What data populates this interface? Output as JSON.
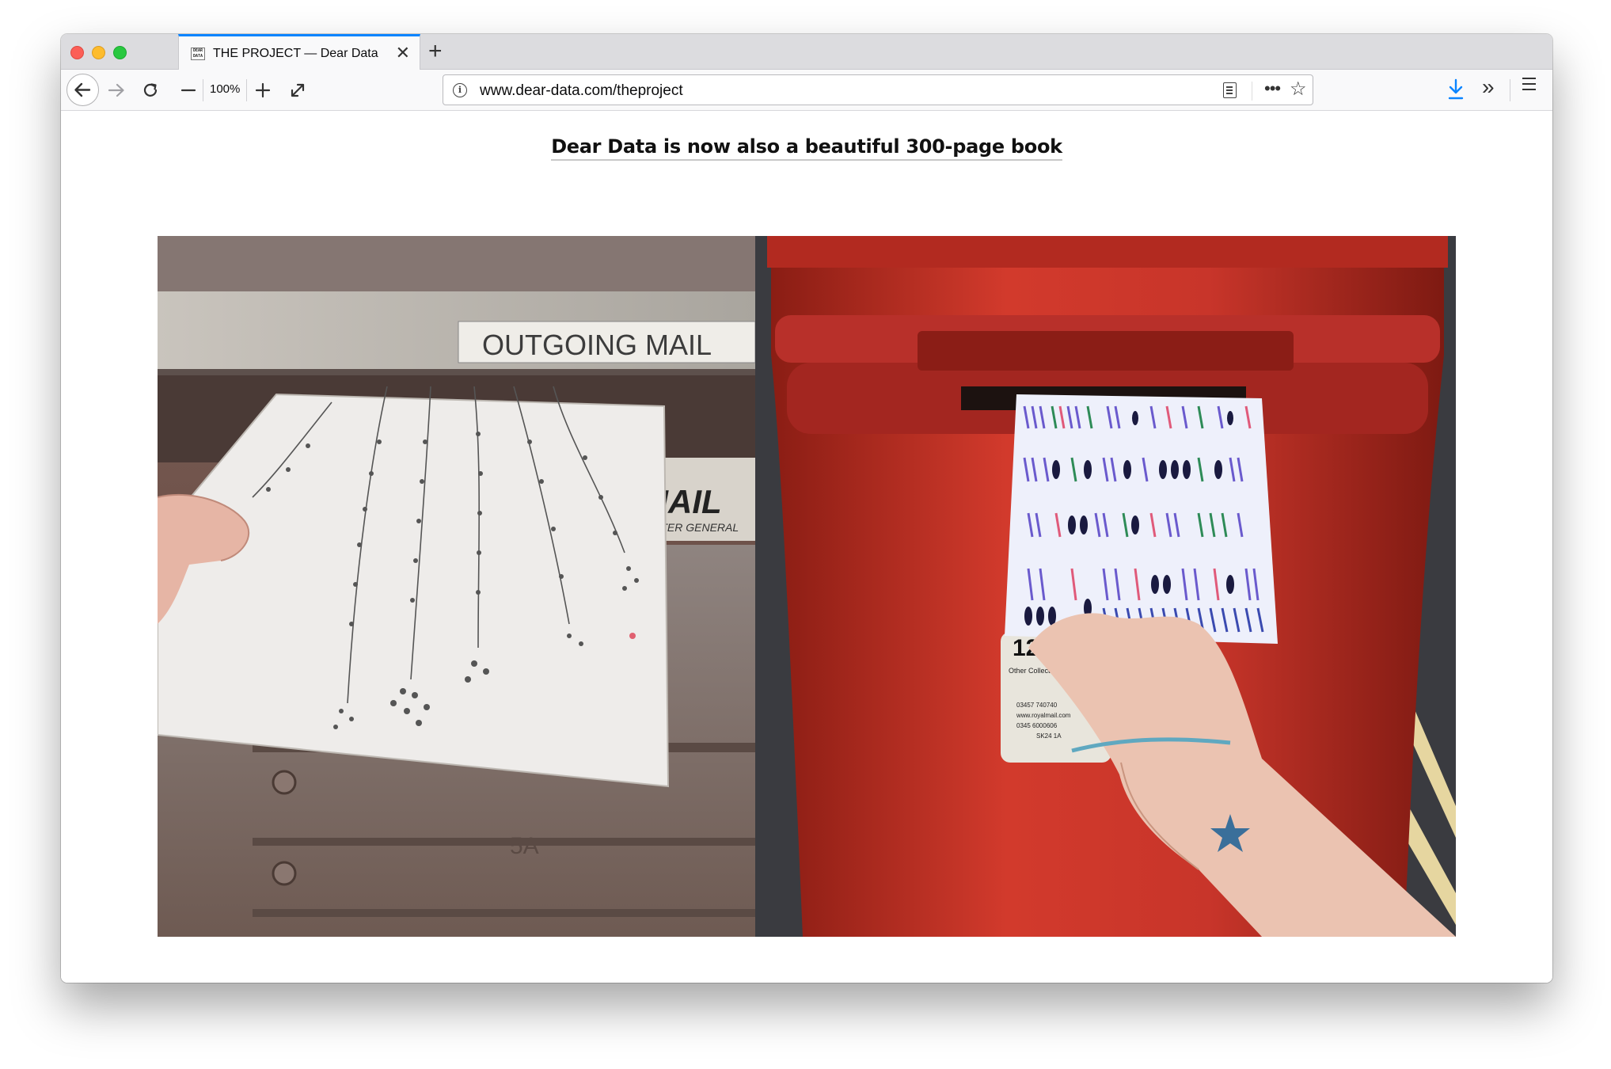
{
  "browser": {
    "tab": {
      "title": "THE PROJECT — Dear Data",
      "favicon_text": "DEAR DATA",
      "close_icon": "close-icon"
    },
    "new_tab_icon": "plus-icon",
    "zoom_level": "100%",
    "url": "www.dear-data.com/theproject",
    "accent_color": "#0a84ff"
  },
  "page": {
    "book_link_text": "Dear Data is now also a beautiful 300-page book",
    "left_photo": {
      "sign_text": "OUTGOING MAIL",
      "mail_sign_text": "MAIL",
      "mail_sign_sub": "MASTER GENERAL",
      "box_number": "5A"
    },
    "right_photo": {
      "collection_time": "12",
      "collection_label": "Other Collections",
      "phone_1": "03457 740740",
      "website": "www.royalmail.com",
      "phone_2": "0345 6000606",
      "postcode": "SK24 1A"
    }
  }
}
